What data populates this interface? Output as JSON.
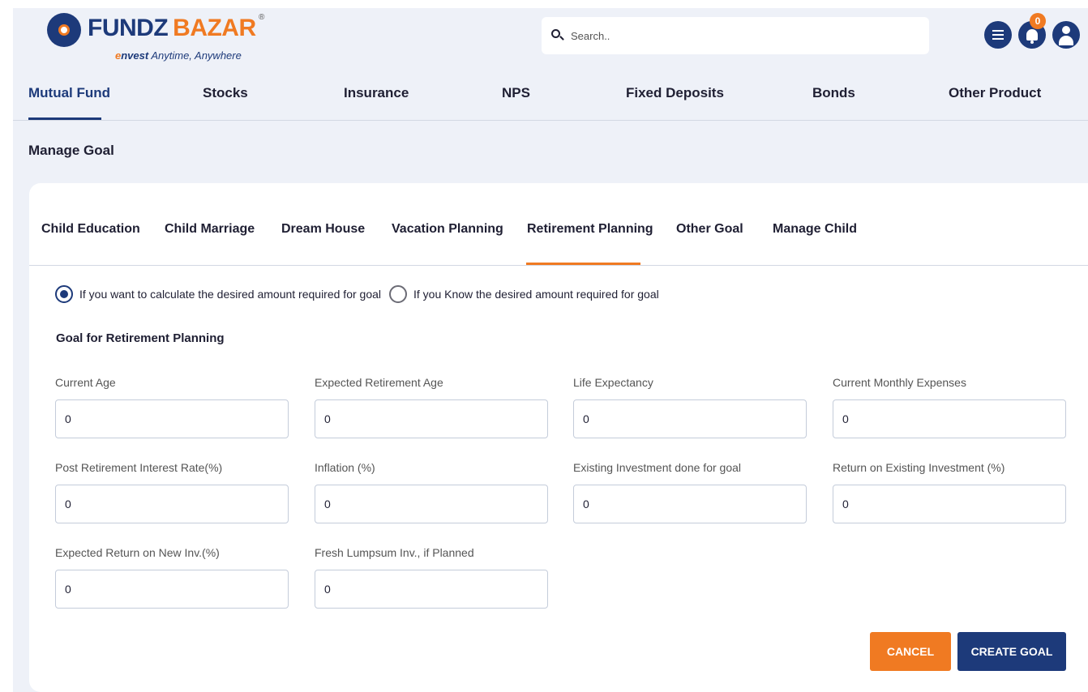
{
  "brand": {
    "name_part1": "FUNDZ",
    "name_part2": "BAZAR",
    "registered": "®",
    "tagline_e": "e",
    "tagline_nvest": "nvest",
    "tagline_rest": " Anytime, Anywhere"
  },
  "search": {
    "placeholder": "Search.."
  },
  "header": {
    "icons": [
      "list-icon",
      "bell-icon",
      "user-icon"
    ],
    "notification_count": "0"
  },
  "nav": {
    "items": [
      {
        "label": "Mutual Fund",
        "active": true
      },
      {
        "label": "Stocks"
      },
      {
        "label": "Insurance"
      },
      {
        "label": "NPS"
      },
      {
        "label": "Fixed Deposits"
      },
      {
        "label": "Bonds"
      },
      {
        "label": "Other Product"
      }
    ]
  },
  "page": {
    "title": "Manage Goal"
  },
  "tabs": {
    "items": [
      {
        "label": "Child Education"
      },
      {
        "label": "Child Marriage"
      },
      {
        "label": "Dream House"
      },
      {
        "label": "Vacation Planning"
      },
      {
        "label": "Retirement Planning",
        "active": true
      },
      {
        "label": "Other Goal"
      },
      {
        "label": "Manage Child"
      }
    ]
  },
  "mode": {
    "option1": "If you want to calculate the desired amount required for goal",
    "option2": "If you Know the desired amount required for goal",
    "selected": "option1"
  },
  "form": {
    "section_title": "Goal for Retirement Planning",
    "fields": [
      {
        "label": "Current Age",
        "value": "0"
      },
      {
        "label": "Expected Retirement Age",
        "value": "0"
      },
      {
        "label": "Life Expectancy",
        "value": "0"
      },
      {
        "label": "Current Monthly Expenses",
        "value": "0"
      },
      {
        "label": "Post Retirement Interest Rate(%)",
        "value": "0"
      },
      {
        "label": "Inflation (%)",
        "value": "0"
      },
      {
        "label": "Existing Investment done for goal",
        "value": "0"
      },
      {
        "label": "Return on Existing Investment (%)",
        "value": "0"
      },
      {
        "label": "Expected Return on New Inv.(%)",
        "value": "0"
      },
      {
        "label": "Fresh Lumpsum Inv., if Planned",
        "value": "0"
      }
    ]
  },
  "buttons": {
    "cancel": "CANCEL",
    "create": "CREATE GOAL"
  },
  "colors": {
    "primary": "#1d3a7a",
    "accent": "#f07a22",
    "background": "#eef1f8"
  }
}
